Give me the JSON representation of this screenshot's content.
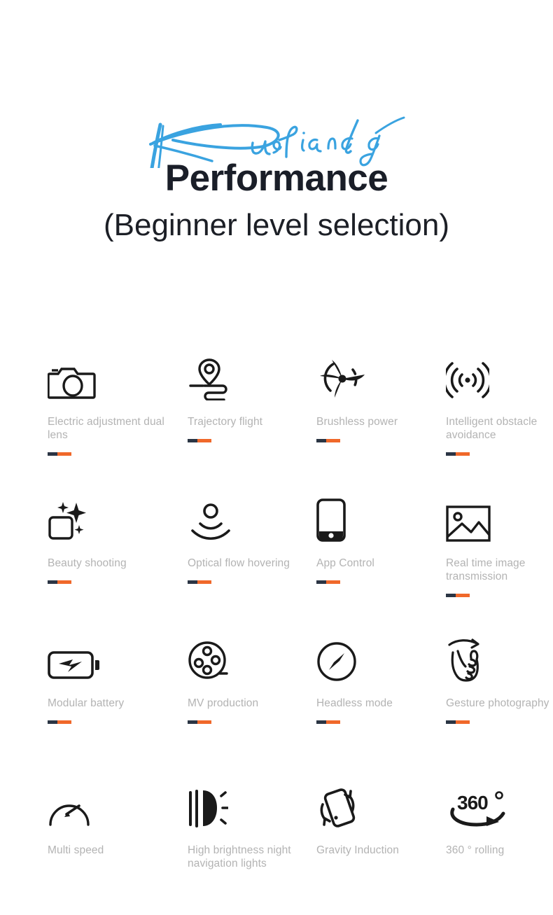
{
  "header": {
    "brand_script": "Kusiandg",
    "brand_script_color": "#3aa3e0",
    "title": "Performance",
    "title_color": "#1a1e28",
    "subtitle": "(Beginner level selection)"
  },
  "theme": {
    "background": "#ffffff",
    "label_color": "#b3b3b3",
    "icon_color": "#1a1a1a",
    "divider_dark": "#2b3544",
    "divider_orange": "#f0682a"
  },
  "features": [
    {
      "label": "Electric adjustment dual lens",
      "icon": "camera-icon",
      "divider": true
    },
    {
      "label": "Trajectory flight",
      "icon": "location-route-icon",
      "divider": true
    },
    {
      "label": "Brushless power",
      "icon": "propeller-icon",
      "divider": true
    },
    {
      "label": "Intelligent obstacle avoidance",
      "icon": "signal-waves-icon",
      "divider": true
    },
    {
      "label": "Beauty shooting",
      "icon": "sparkle-square-icon",
      "divider": true
    },
    {
      "label": "Optical flow hovering",
      "icon": "hover-sensor-icon",
      "divider": true
    },
    {
      "label": "App Control",
      "icon": "smartphone-icon",
      "divider": true
    },
    {
      "label": "Real time image transmission",
      "icon": "photo-image-icon",
      "divider": true
    },
    {
      "label": "Modular battery",
      "icon": "battery-bolt-icon",
      "divider": true
    },
    {
      "label": "MV production",
      "icon": "film-reel-icon",
      "divider": true
    },
    {
      "label": "Headless mode",
      "icon": "compass-icon",
      "divider": true
    },
    {
      "label": "Gesture photography",
      "icon": "hand-gesture-icon",
      "divider": true
    },
    {
      "label": "Multi speed",
      "icon": "speedometer-icon",
      "divider": false
    },
    {
      "label": "High brightness night navigation lights",
      "icon": "headlight-icon",
      "divider": false
    },
    {
      "label": "Gravity Induction",
      "icon": "tilt-phone-icon",
      "divider": false
    },
    {
      "label": "360 ° rolling",
      "icon": "rotate-360-icon",
      "divider": false
    }
  ]
}
